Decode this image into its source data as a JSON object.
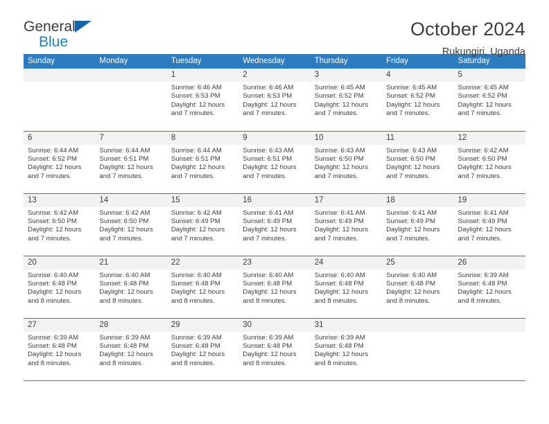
{
  "brand": {
    "name_line1": "General",
    "name_line2": "Blue",
    "triangle_icon": "triangle-icon",
    "color_dark": "#3b3b3b",
    "color_blue": "#1f7fc4"
  },
  "header": {
    "title": "October 2024",
    "subtitle": "Rukungiri, Uganda"
  },
  "theme": {
    "header_row_bg": "#2e7cc0",
    "daynum_bg": "#f2f2f2",
    "row_divider": "#2e7cc0",
    "text": "#3b3b3b"
  },
  "calendar": {
    "weekday_headers": [
      "Sunday",
      "Monday",
      "Tuesday",
      "Wednesday",
      "Thursday",
      "Friday",
      "Saturday"
    ],
    "weeks": [
      [
        {
          "day": "",
          "lines": []
        },
        {
          "day": "",
          "lines": []
        },
        {
          "day": "1",
          "lines": [
            "Sunrise: 6:46 AM",
            "Sunset: 6:53 PM",
            "Daylight: 12 hours",
            "and 7 minutes."
          ]
        },
        {
          "day": "2",
          "lines": [
            "Sunrise: 6:46 AM",
            "Sunset: 6:53 PM",
            "Daylight: 12 hours",
            "and 7 minutes."
          ]
        },
        {
          "day": "3",
          "lines": [
            "Sunrise: 6:45 AM",
            "Sunset: 6:52 PM",
            "Daylight: 12 hours",
            "and 7 minutes."
          ]
        },
        {
          "day": "4",
          "lines": [
            "Sunrise: 6:45 AM",
            "Sunset: 6:52 PM",
            "Daylight: 12 hours",
            "and 7 minutes."
          ]
        },
        {
          "day": "5",
          "lines": [
            "Sunrise: 6:45 AM",
            "Sunset: 6:52 PM",
            "Daylight: 12 hours",
            "and 7 minutes."
          ]
        }
      ],
      [
        {
          "day": "6",
          "lines": [
            "Sunrise: 6:44 AM",
            "Sunset: 6:52 PM",
            "Daylight: 12 hours",
            "and 7 minutes."
          ]
        },
        {
          "day": "7",
          "lines": [
            "Sunrise: 6:44 AM",
            "Sunset: 6:51 PM",
            "Daylight: 12 hours",
            "and 7 minutes."
          ]
        },
        {
          "day": "8",
          "lines": [
            "Sunrise: 6:44 AM",
            "Sunset: 6:51 PM",
            "Daylight: 12 hours",
            "and 7 minutes."
          ]
        },
        {
          "day": "9",
          "lines": [
            "Sunrise: 6:43 AM",
            "Sunset: 6:51 PM",
            "Daylight: 12 hours",
            "and 7 minutes."
          ]
        },
        {
          "day": "10",
          "lines": [
            "Sunrise: 6:43 AM",
            "Sunset: 6:50 PM",
            "Daylight: 12 hours",
            "and 7 minutes."
          ]
        },
        {
          "day": "11",
          "lines": [
            "Sunrise: 6:43 AM",
            "Sunset: 6:50 PM",
            "Daylight: 12 hours",
            "and 7 minutes."
          ]
        },
        {
          "day": "12",
          "lines": [
            "Sunrise: 6:42 AM",
            "Sunset: 6:50 PM",
            "Daylight: 12 hours",
            "and 7 minutes."
          ]
        }
      ],
      [
        {
          "day": "13",
          "lines": [
            "Sunrise: 6:42 AM",
            "Sunset: 6:50 PM",
            "Daylight: 12 hours",
            "and 7 minutes."
          ]
        },
        {
          "day": "14",
          "lines": [
            "Sunrise: 6:42 AM",
            "Sunset: 6:50 PM",
            "Daylight: 12 hours",
            "and 7 minutes."
          ]
        },
        {
          "day": "15",
          "lines": [
            "Sunrise: 6:42 AM",
            "Sunset: 6:49 PM",
            "Daylight: 12 hours",
            "and 7 minutes."
          ]
        },
        {
          "day": "16",
          "lines": [
            "Sunrise: 6:41 AM",
            "Sunset: 6:49 PM",
            "Daylight: 12 hours",
            "and 7 minutes."
          ]
        },
        {
          "day": "17",
          "lines": [
            "Sunrise: 6:41 AM",
            "Sunset: 6:49 PM",
            "Daylight: 12 hours",
            "and 7 minutes."
          ]
        },
        {
          "day": "18",
          "lines": [
            "Sunrise: 6:41 AM",
            "Sunset: 6:49 PM",
            "Daylight: 12 hours",
            "and 7 minutes."
          ]
        },
        {
          "day": "19",
          "lines": [
            "Sunrise: 6:41 AM",
            "Sunset: 6:49 PM",
            "Daylight: 12 hours",
            "and 7 minutes."
          ]
        }
      ],
      [
        {
          "day": "20",
          "lines": [
            "Sunrise: 6:40 AM",
            "Sunset: 6:48 PM",
            "Daylight: 12 hours",
            "and 8 minutes."
          ]
        },
        {
          "day": "21",
          "lines": [
            "Sunrise: 6:40 AM",
            "Sunset: 6:48 PM",
            "Daylight: 12 hours",
            "and 8 minutes."
          ]
        },
        {
          "day": "22",
          "lines": [
            "Sunrise: 6:40 AM",
            "Sunset: 6:48 PM",
            "Daylight: 12 hours",
            "and 8 minutes."
          ]
        },
        {
          "day": "23",
          "lines": [
            "Sunrise: 6:40 AM",
            "Sunset: 6:48 PM",
            "Daylight: 12 hours",
            "and 8 minutes."
          ]
        },
        {
          "day": "24",
          "lines": [
            "Sunrise: 6:40 AM",
            "Sunset: 6:48 PM",
            "Daylight: 12 hours",
            "and 8 minutes."
          ]
        },
        {
          "day": "25",
          "lines": [
            "Sunrise: 6:40 AM",
            "Sunset: 6:48 PM",
            "Daylight: 12 hours",
            "and 8 minutes."
          ]
        },
        {
          "day": "26",
          "lines": [
            "Sunrise: 6:39 AM",
            "Sunset: 6:48 PM",
            "Daylight: 12 hours",
            "and 8 minutes."
          ]
        }
      ],
      [
        {
          "day": "27",
          "lines": [
            "Sunrise: 6:39 AM",
            "Sunset: 6:48 PM",
            "Daylight: 12 hours",
            "and 8 minutes."
          ]
        },
        {
          "day": "28",
          "lines": [
            "Sunrise: 6:39 AM",
            "Sunset: 6:48 PM",
            "Daylight: 12 hours",
            "and 8 minutes."
          ]
        },
        {
          "day": "29",
          "lines": [
            "Sunrise: 6:39 AM",
            "Sunset: 6:48 PM",
            "Daylight: 12 hours",
            "and 8 minutes."
          ]
        },
        {
          "day": "30",
          "lines": [
            "Sunrise: 6:39 AM",
            "Sunset: 6:48 PM",
            "Daylight: 12 hours",
            "and 8 minutes."
          ]
        },
        {
          "day": "31",
          "lines": [
            "Sunrise: 6:39 AM",
            "Sunset: 6:48 PM",
            "Daylight: 12 hours",
            "and 8 minutes."
          ]
        },
        {
          "day": "",
          "lines": []
        },
        {
          "day": "",
          "lines": []
        }
      ]
    ]
  }
}
